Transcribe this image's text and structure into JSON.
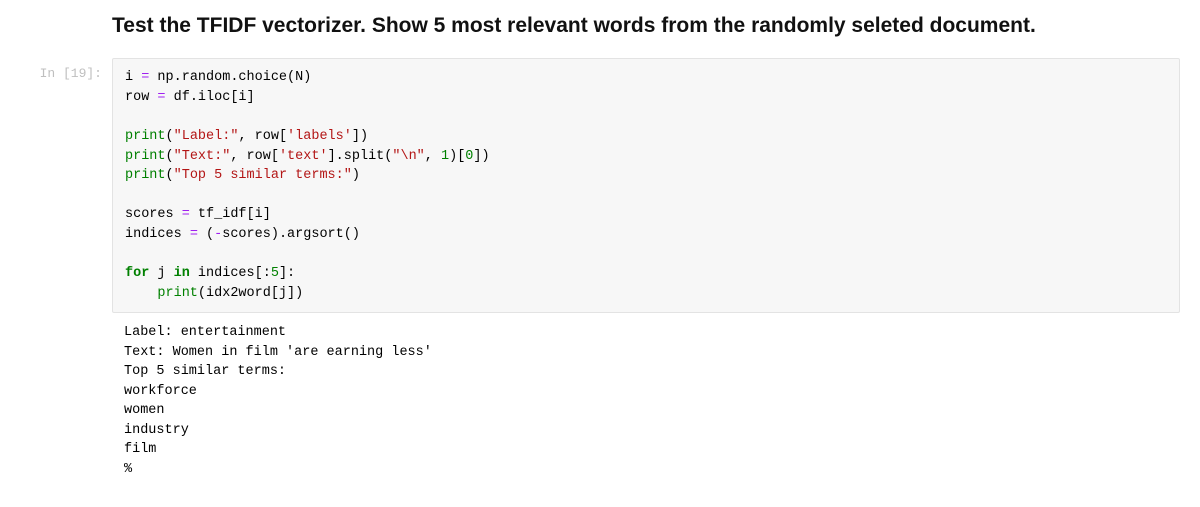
{
  "markdown": {
    "title": "Test the TFIDF vectorizer. Show 5 most relevant words from the randomly seleted document."
  },
  "cell": {
    "prompt": "In [19]:",
    "code_plain": "i = np.random.choice(N)\nrow = df.iloc[i]\n\nprint(\"Label:\", row['labels'])\nprint(\"Text:\", row['text'].split(\"\\n\", 1)[0])\nprint(\"Top 5 similar terms:\")\n\nscores = tf_idf[i]\nindices = (-scores).argsort()\n\nfor j in indices[:5]:\n    print(idx2word[j])",
    "output": "Label: entertainment\nText: Women in film 'are earning less'\nTop 5 similar terms:\nworkforce\nwomen\nindustry\nfilm\n%"
  },
  "tokens": {
    "s_label": "\"Label:\"",
    "s_labels": "'labels'",
    "s_text_lbl": "\"Text:\"",
    "s_text": "'text'",
    "s_nl": "\"\\n\"",
    "s_top5": "\"Top 5 similar terms:\"",
    "n_1": "1",
    "n_0": "0",
    "n_5": "5",
    "kw_for": "for",
    "kw_in": "in",
    "b_print": "print",
    "op_eq": "=",
    "op_minus": "-"
  }
}
